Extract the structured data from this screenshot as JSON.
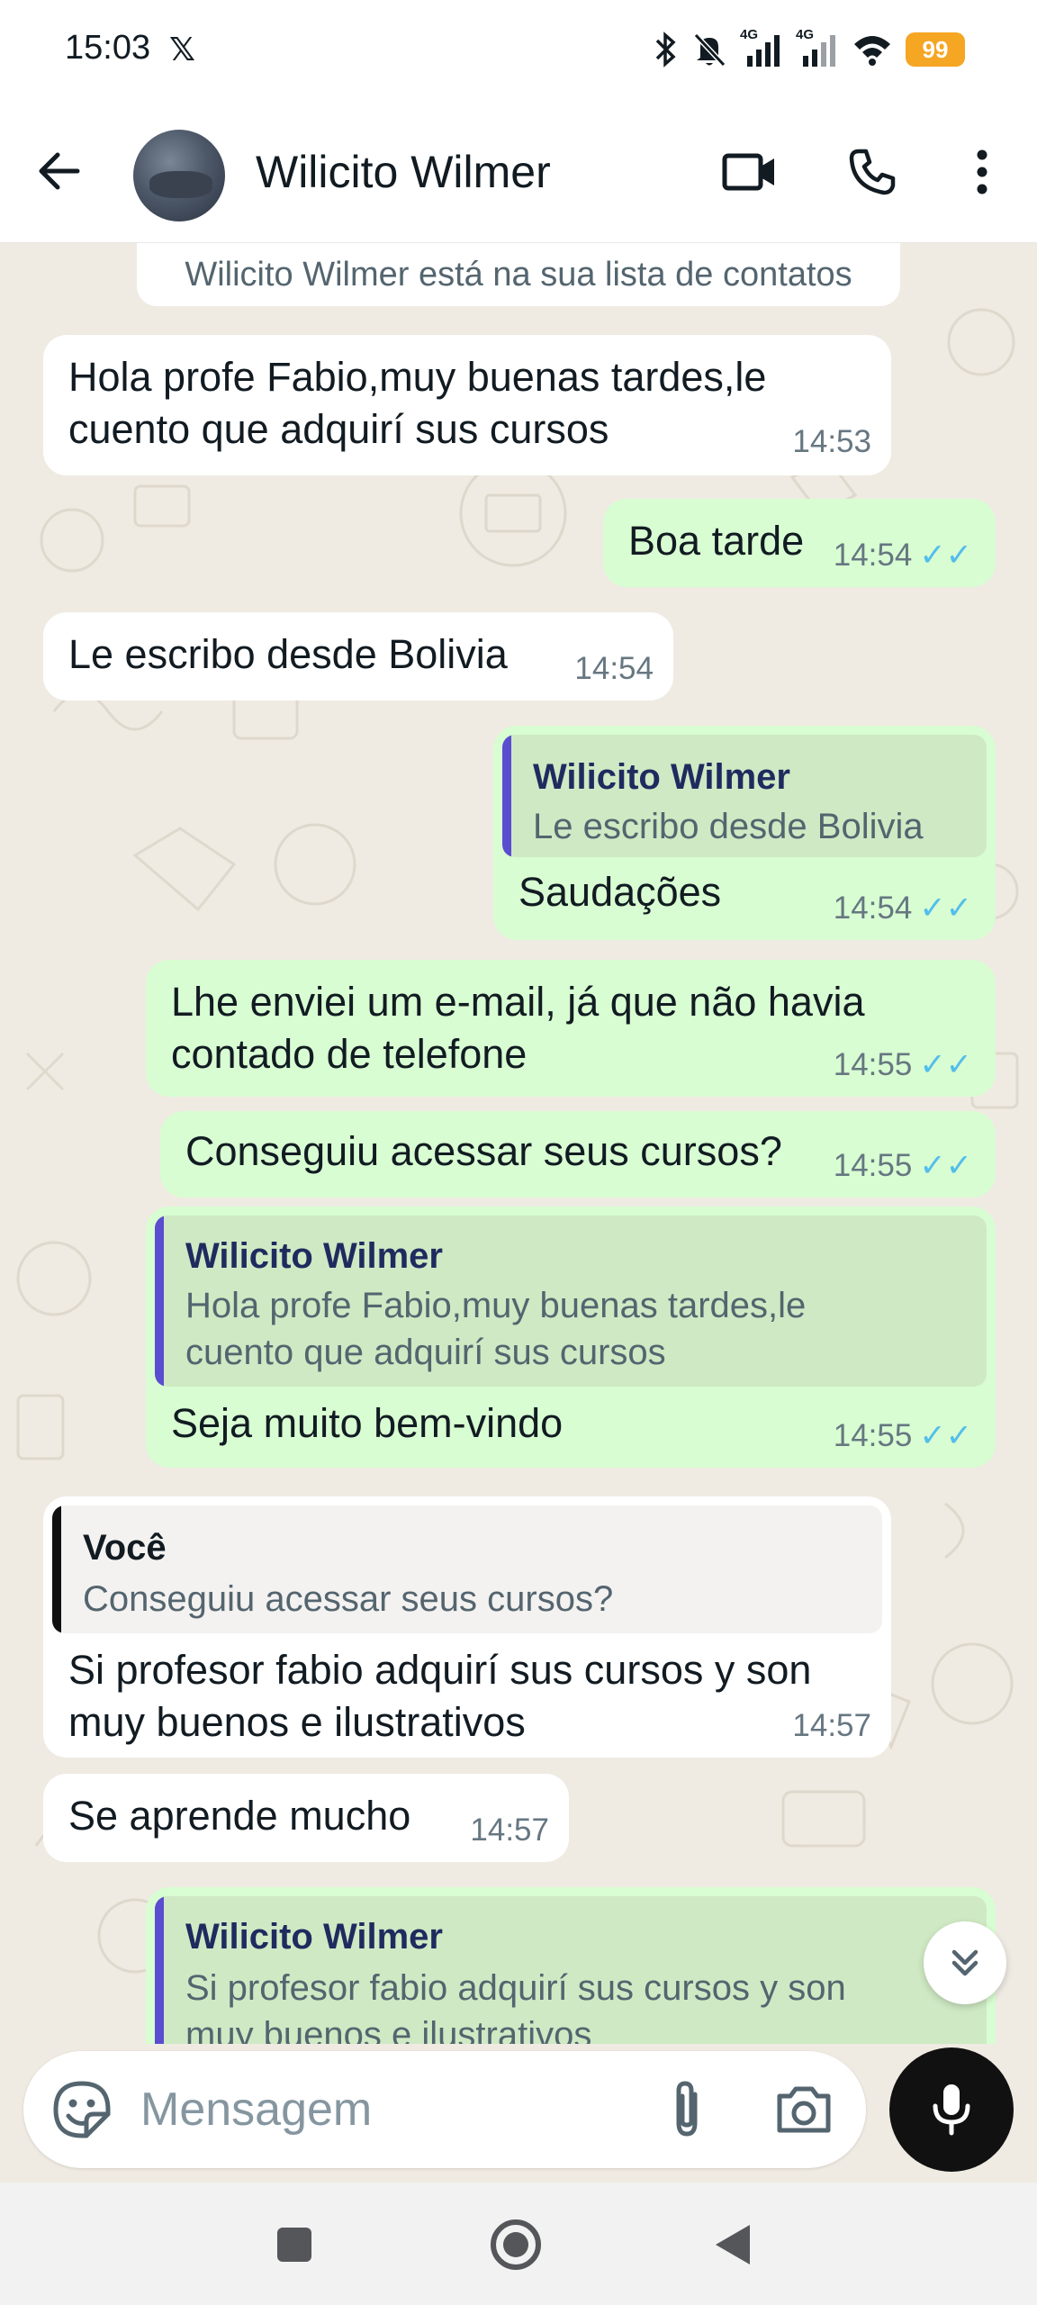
{
  "status_bar": {
    "time": "15:03",
    "x_icon": "x-logo-icon",
    "battery": "99",
    "network_label_1": "4G",
    "network_label_2": "4G",
    "battery_color": "#f5a623"
  },
  "header": {
    "contact_name": "Wilicito Wilmer",
    "icons": [
      "back-arrow-icon",
      "video-call-icon",
      "phone-icon",
      "more-vert-icon"
    ]
  },
  "chat": {
    "notice": "Wilicito Wilmer está na sua lista de contatos",
    "bubble_colors": {
      "incoming": "#ffffff",
      "outgoing": "#d9fdd3",
      "read_ticks": "#53bdeb"
    },
    "messages": [
      {
        "direction": "in",
        "lines": [
          "Hola profe Fabio,muy buenas tardes,le",
          "cuento que adquirí sus cursos"
        ],
        "time": "14:53"
      },
      {
        "direction": "out",
        "text": "Boa tarde",
        "time": "14:54",
        "status": "read"
      },
      {
        "direction": "in",
        "text": "Le escribo desde Bolivia",
        "time": "14:54"
      },
      {
        "direction": "out",
        "quote": {
          "author": "Wilicito Wilmer",
          "lines": [
            "Le escribo desde Bolivia"
          ]
        },
        "text": "Saudações",
        "time": "14:54",
        "status": "read"
      },
      {
        "direction": "out",
        "lines": [
          "Lhe enviei um e-mail, já que não havia",
          "contado de telefone"
        ],
        "time": "14:55",
        "status": "read"
      },
      {
        "direction": "out",
        "text": "Conseguiu acessar seus cursos?",
        "time": "14:55",
        "status": "read"
      },
      {
        "direction": "out",
        "quote": {
          "author": "Wilicito Wilmer",
          "lines": [
            "Hola profe Fabio,muy buenas tardes,le",
            "cuento que adquirí sus cursos"
          ]
        },
        "text": "Seja muito bem-vindo",
        "time": "14:55",
        "status": "read"
      },
      {
        "direction": "in",
        "quote": {
          "author": "Você",
          "lines": [
            "Conseguiu acessar seus cursos?"
          ]
        },
        "lines": [
          "Si profesor fabio adquirí sus cursos y son",
          "muy buenos e ilustrativos"
        ],
        "time": "14:57"
      },
      {
        "direction": "in",
        "text": "Se aprende mucho",
        "time": "14:57"
      },
      {
        "direction": "out",
        "quote": {
          "author": "Wilicito Wilmer",
          "lines": [
            "Si profesor fabio adquirí sus cursos y son",
            "muy buenos e ilustrativos"
          ]
        },
        "partial": true
      }
    ]
  },
  "composer": {
    "placeholder": "Mensagem",
    "value": "",
    "icons": [
      "emoji-sticker-icon",
      "attach-icon",
      "camera-icon",
      "mic-icon"
    ]
  },
  "nav_bar": {
    "icons": [
      "recents-square-icon",
      "home-circle-icon",
      "back-triangle-icon"
    ]
  }
}
